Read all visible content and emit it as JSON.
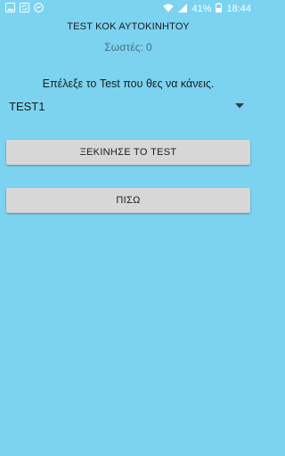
{
  "status_bar": {
    "left_icons": [
      "image-icon",
      "sync-icon",
      "messenger-icon"
    ],
    "battery_percent": "41%",
    "time": "18:44"
  },
  "header": {
    "title": "TEST ΚΟΚ ΑΥΤΟΚΙΝΗΤΟΥ",
    "score": "Σωστές: 0"
  },
  "main": {
    "prompt": "Επέλεξε το Test που θες να κάνεις.",
    "test_select": {
      "selected": "TEST1"
    },
    "start_button_label": "ΞΕΚΙΝΗΣΕ ΤΟ TEST",
    "back_button_label": "ΠΙΣΩ"
  },
  "colors": {
    "background": "#7bd3f0",
    "button": "#d7d7d7",
    "text": "#1c1c1c"
  }
}
